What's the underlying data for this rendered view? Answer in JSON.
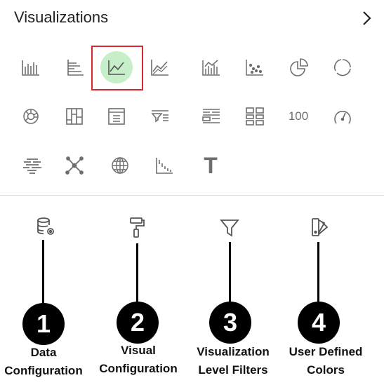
{
  "panel": {
    "title": "Visualizations",
    "next_icon": "chevron-right-icon"
  },
  "gallery": {
    "selected": "line-chart",
    "icons": [
      "bar-chart",
      "horizontal-bar-chart",
      "line-chart",
      "area-chart",
      "combo-chart",
      "scatter-chart",
      "pie-chart",
      "donut-chart",
      "sunburst-chart",
      "pivot-table",
      "table",
      "filter-list",
      "grouped-list",
      "tile-grid",
      "100",
      "gauge",
      "word-cloud",
      "network-graph",
      "map",
      "waterfall",
      "T"
    ]
  },
  "config": [
    {
      "number": "1",
      "line1": "Data",
      "line2": "Configuration",
      "icon": "database-gear-icon"
    },
    {
      "number": "2",
      "line1": "Visual",
      "line2": "Configuration",
      "icon": "paint-roller-icon"
    },
    {
      "number": "3",
      "line1": "Visualization",
      "line2": "Level Filters",
      "icon": "filter-icon"
    },
    {
      "number": "4",
      "line1": "User Defined",
      "line2": "Colors",
      "icon": "color-palette-icon"
    }
  ],
  "colors": {
    "accent_selected_bg": "#c6eec9",
    "selected_border": "#d7262e",
    "icon": "#6e6e6e"
  }
}
